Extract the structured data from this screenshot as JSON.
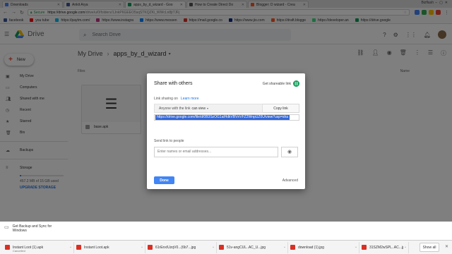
{
  "browser": {
    "tabs": [
      {
        "label": "Downloads",
        "color": "#4285f4"
      },
      {
        "label": "Ankit Arya",
        "color": "#3b5998"
      },
      {
        "label": "apps_by_d_wizard - Goo",
        "color": "#0f9d58"
      },
      {
        "label": "How to Create Direct Do",
        "color": "#555555"
      },
      {
        "label": "Blogger: D wizard - Crea",
        "color": "#ff5722"
      }
    ],
    "window_user": "Bizflash",
    "secure_label": "Secure",
    "url_host": "https://drive.google.com",
    "url_path": "/drive/u/0/folders/1JnkP6GEEO5sqSTKQZKi_WWcLn8jt7JFj",
    "bookmarks": [
      {
        "label": "facebook",
        "color": "#3b5998"
      },
      {
        "label": "you tube",
        "color": "#ff0000"
      },
      {
        "label": "https://paytm.com/",
        "color": "#00baf2"
      },
      {
        "label": "https://www.instagra",
        "color": "#c13584"
      },
      {
        "label": "https://www.messen",
        "color": "#0084ff"
      },
      {
        "label": "https://mail.google.co",
        "color": "#d93025"
      },
      {
        "label": "https://www.jio.com",
        "color": "#0a2885"
      },
      {
        "label": "https://draft.blogge",
        "color": "#ff5722"
      },
      {
        "label": "https://developer.an",
        "color": "#3ddc84"
      },
      {
        "label": "https://drive.google",
        "color": "#0f9d58"
      }
    ]
  },
  "drive": {
    "app_name": "Drive",
    "search_placeholder": "Search Drive",
    "new_label": "New",
    "nav": [
      {
        "label": "My Drive",
        "icon": "folder-icon"
      },
      {
        "label": "Computers",
        "icon": "computer-icon"
      },
      {
        "label": "Shared with me",
        "icon": "people-icon"
      },
      {
        "label": "Recent",
        "icon": "clock-icon"
      },
      {
        "label": "Starred",
        "icon": "star-icon"
      },
      {
        "label": "Bin",
        "icon": "trash-icon"
      }
    ],
    "backups_label": "Backups",
    "storage_label": "Storage",
    "storage_used": "457.2 MB of 15 GB used",
    "storage_fraction": 0.03,
    "upgrade_label": "UPGRADE STORAGE",
    "backup_sync_label": "Get Backup and Sync for Windows",
    "breadcrumb_root": "My Drive",
    "breadcrumb_current": "apps_by_d_wizard",
    "files_header": "Files",
    "name_header": "Name",
    "file_name": "base.apk"
  },
  "share_dialog": {
    "title": "Share with others",
    "shareable_label": "Get shareable link",
    "link_status": "Link sharing on",
    "learn_more": "Learn more",
    "permission_prefix": "Anyone with the link",
    "permission_value": "can view",
    "copy_label": "Copy link",
    "link_url": "https://drive.google.com/file/d/0B3SzOG1alHdkVBVnVFZ2WnpUZ0U/view?usp=sha",
    "send_label": "Send link to people",
    "email_placeholder": "Enter names or email addresses...",
    "done_label": "Done",
    "advanced_label": "Advanced"
  },
  "downloads": {
    "items": [
      {
        "name": "Instant Loot (1).apk",
        "sub": "Cancelled",
        "color": "#d93025"
      },
      {
        "name": "Instant Loot.apk",
        "sub": "",
        "color": "#d93025"
      },
      {
        "name": "61rEnxIUzqV0...(6b7...jpg",
        "sub": "",
        "color": "#d93025"
      },
      {
        "name": "51v-angCUL..AC_U...jpg",
        "sub": "",
        "color": "#d93025"
      },
      {
        "name": "download (1).jpg",
        "sub": "",
        "color": "#d93025"
      },
      {
        "name": "31SZM2wSPL..AC...jpg",
        "sub": "",
        "color": "#d93025"
      }
    ],
    "show_all_label": "Show all"
  }
}
